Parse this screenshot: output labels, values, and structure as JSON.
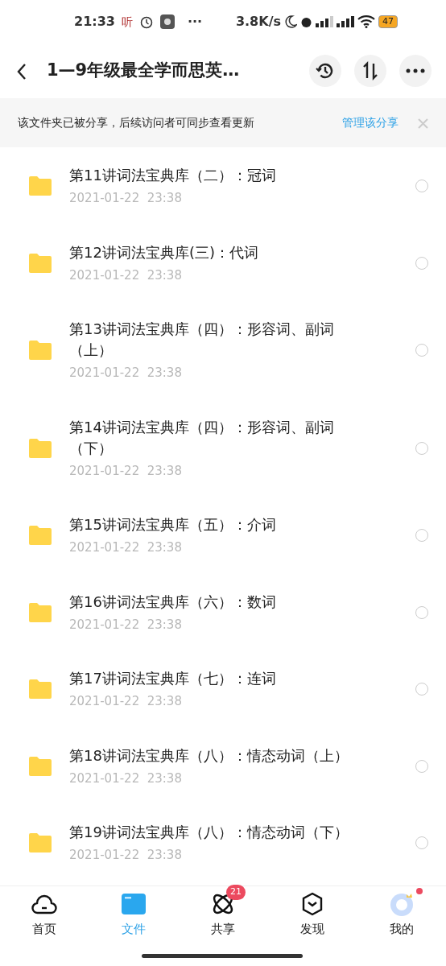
{
  "status_bar": {
    "time": "21:33",
    "app_glyph": "听",
    "more": "···",
    "speed": "3.8K/s",
    "battery": "47"
  },
  "header": {
    "title": "1—9年级最全学而思英…"
  },
  "share_banner": {
    "message": "该文件夹已被分享，后续访问者可同步查看更新",
    "action": "管理该分享"
  },
  "files": [
    {
      "name": "第11讲词法宝典库（二）：冠词",
      "date": "2021-01-22",
      "time": "23:38",
      "selected": false
    },
    {
      "name": "第12讲词法宝典库(三)：代词",
      "date": "2021-01-22",
      "time": "23:38",
      "selected": false
    },
    {
      "name": "第13讲词法宝典库（四）：形容词、副词（上）",
      "date": "2021-01-22",
      "time": "23:38",
      "selected": false
    },
    {
      "name": "第14讲词法宝典库（四）：形容词、副词（下）",
      "date": "2021-01-22",
      "time": "23:38",
      "selected": false
    },
    {
      "name": "第15讲词法宝典库（五）：介词",
      "date": "2021-01-22",
      "time": "23:38",
      "selected": false
    },
    {
      "name": "第16讲词法宝典库（六）：数词",
      "date": "2021-01-22",
      "time": "23:38",
      "selected": false
    },
    {
      "name": "第17讲词法宝典库（七）：连词",
      "date": "2021-01-22",
      "time": "23:38",
      "selected": false
    },
    {
      "name": "第18讲词法宝典库（八）：情态动词（上）",
      "date": "2021-01-22",
      "time": "23:38",
      "selected": false
    },
    {
      "name": "第19讲词法宝典库（八）：情态动词（下）",
      "date": "2021-01-22",
      "time": "23:38",
      "selected": false
    }
  ],
  "bottom_nav": [
    {
      "kind": "home",
      "label": "首页",
      "selected": false
    },
    {
      "kind": "files",
      "label": "文件",
      "selected": true
    },
    {
      "kind": "share",
      "label": "共享",
      "selected": false,
      "badge": "21"
    },
    {
      "kind": "discover",
      "label": "发现",
      "selected": false
    },
    {
      "kind": "me",
      "label": "我的",
      "selected": false,
      "dot": true
    }
  ]
}
